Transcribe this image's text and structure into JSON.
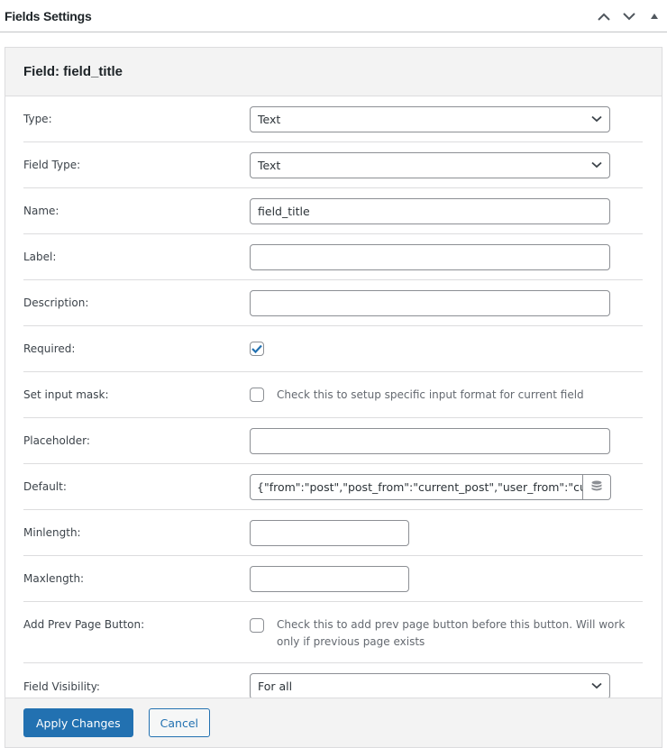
{
  "panel": {
    "title": "Fields Settings",
    "actions": [
      {
        "name": "move-up",
        "icon": "chevron-up-icon"
      },
      {
        "name": "move-down",
        "icon": "chevron-down-icon"
      },
      {
        "name": "toggle-panel",
        "icon": "triangle-up-icon"
      }
    ]
  },
  "modal": {
    "title": "Field: field_title",
    "rows": {
      "type": {
        "label": "Type:",
        "value": "Text"
      },
      "field_type": {
        "label": "Field Type:",
        "value": "Text"
      },
      "name": {
        "label": "Name:",
        "value": "field_title"
      },
      "label": {
        "label": "Label:",
        "value": ""
      },
      "description": {
        "label": "Description:",
        "value": ""
      },
      "required": {
        "label": "Required:",
        "checked": true
      },
      "input_mask": {
        "label": "Set input mask:",
        "checked": false,
        "hint": "Check this to setup specific input format for current field"
      },
      "placeholder": {
        "label": "Placeholder:",
        "value": ""
      },
      "default": {
        "label": "Default:",
        "value": "{\"from\":\"post\",\"post_from\":\"current_post\",\"user_from\":\"current_user\"",
        "button_icon": "database-icon"
      },
      "minlength": {
        "label": "Minlength:",
        "value": ""
      },
      "maxlength": {
        "label": "Maxlength:",
        "value": ""
      },
      "prev_page": {
        "label": "Add Prev Page Button:",
        "checked": false,
        "hint": "Check this to add prev page button before this button. Will work only if previous page exists"
      },
      "visibility": {
        "label": "Field Visibility:",
        "value": "For all"
      }
    },
    "footer": {
      "apply_label": "Apply Changes",
      "cancel_label": "Cancel"
    }
  },
  "colors": {
    "primary": "#2271b1",
    "header_bg": "#f3f3f3",
    "border": "#dcdcde",
    "input_border": "#8c8f94"
  }
}
